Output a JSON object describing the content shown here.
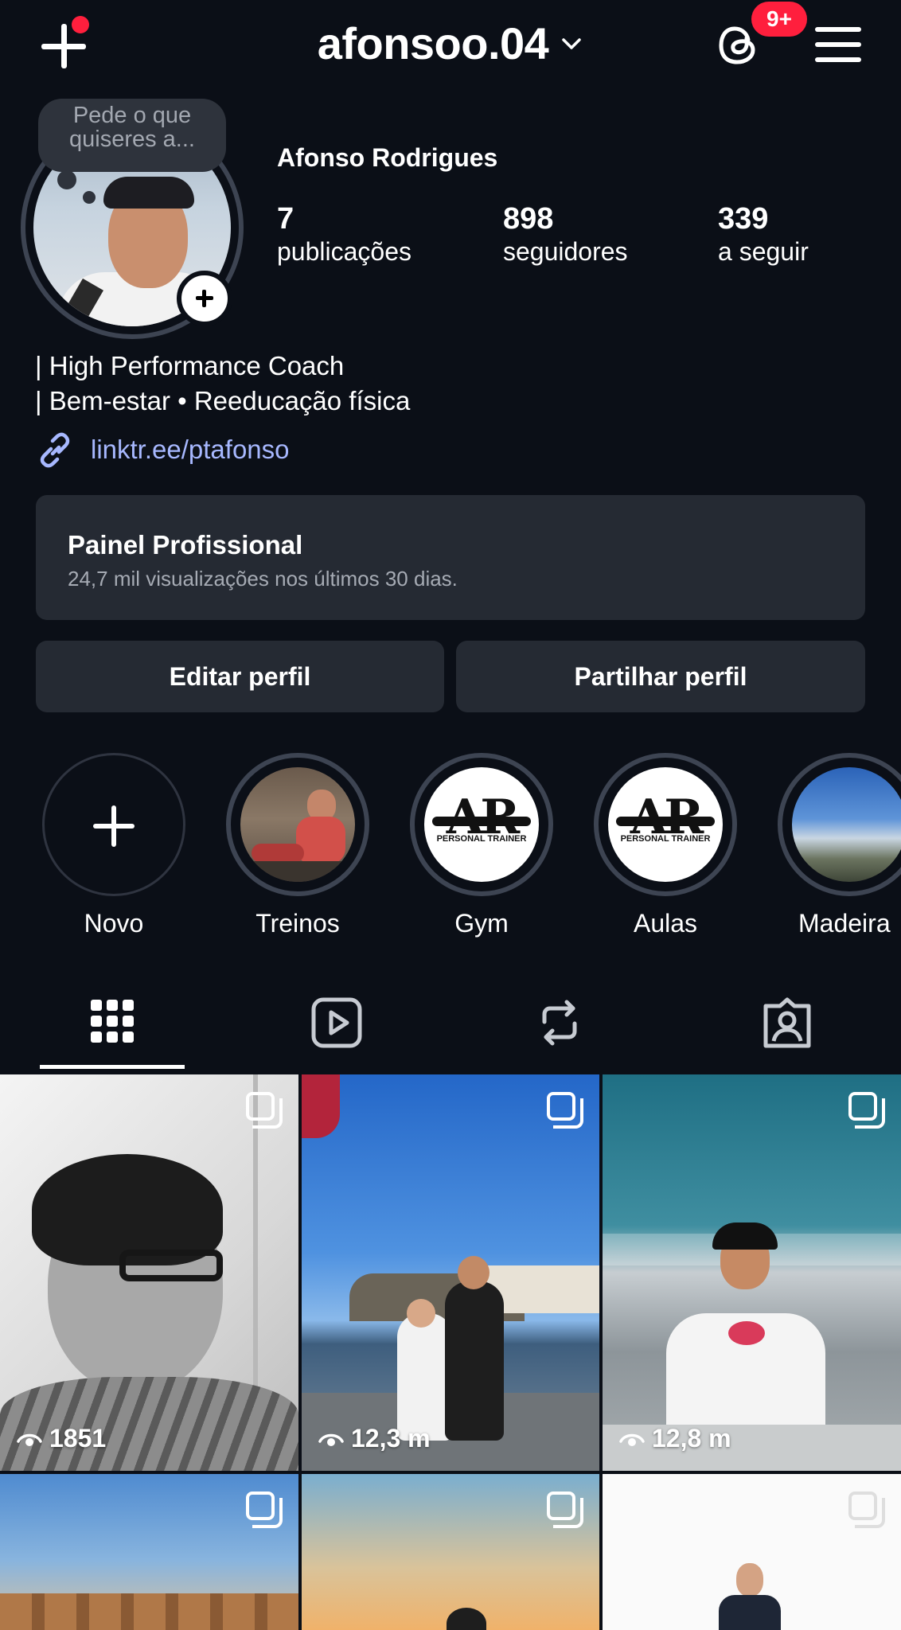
{
  "header": {
    "username": "afonsoo.04",
    "notification_badge": "9+"
  },
  "profile": {
    "note": "Pede o que quiseres a...",
    "full_name": "Afonso Rodrigues",
    "stats": [
      {
        "value": "7",
        "label": "publicações"
      },
      {
        "value": "898",
        "label": "seguidores"
      },
      {
        "value": "339",
        "label": "a seguir"
      }
    ],
    "bio": [
      "| High Performance Coach",
      "| Bem-estar • Reeducação física"
    ],
    "link": "linktr.ee/ptafonso"
  },
  "professional_panel": {
    "title": "Painel Profissional",
    "subtitle": "24,7 mil visualizações nos últimos 30 dias."
  },
  "actions": {
    "edit": "Editar perfil",
    "share": "Partilhar perfil"
  },
  "highlights": [
    {
      "label": "Novo",
      "icon": "plus-icon"
    },
    {
      "label": "Treinos",
      "icon": "photo"
    },
    {
      "label": "Gym",
      "icon": "ar-logo"
    },
    {
      "label": "Aulas",
      "icon": "ar-logo"
    },
    {
      "label": "Madeira",
      "icon": "photo"
    }
  ],
  "ar_logo": {
    "letters": "AR",
    "tagline": "PERSONAL TRAINER"
  },
  "tabs": [
    {
      "name": "grid-icon",
      "active": true
    },
    {
      "name": "reels-icon",
      "active": false
    },
    {
      "name": "reposts-icon",
      "active": false
    },
    {
      "name": "tagged-icon",
      "active": false
    }
  ],
  "posts": [
    {
      "views": "1851",
      "multi": true
    },
    {
      "views": "12,3 m",
      "multi": true
    },
    {
      "views": "12,8 m",
      "multi": true
    },
    {
      "views": "",
      "multi": true
    },
    {
      "views": "",
      "multi": true
    },
    {
      "views": "",
      "multi": true
    }
  ],
  "colors": {
    "background": "#0b0f17",
    "surface": "#252a33",
    "badge": "#ff1f3d",
    "link": "#a7b8ff"
  }
}
